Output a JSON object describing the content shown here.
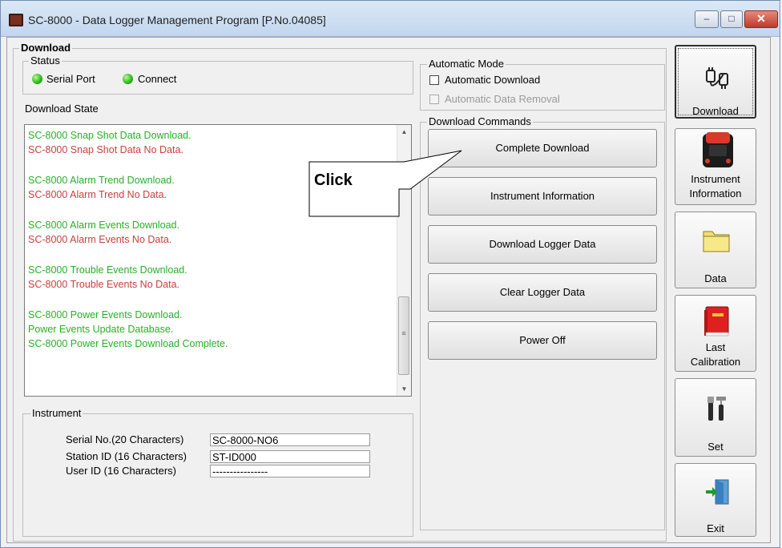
{
  "window": {
    "title": "SC-8000  - Data Logger Management Program [P.No.04085]",
    "controls": {
      "minimize": "–",
      "maximize": "□",
      "close": "✕"
    }
  },
  "download_group": {
    "label": "Download",
    "status": {
      "label": "Status",
      "serial_port": "Serial Port",
      "connect": "Connect"
    },
    "download_state_label": "Download State",
    "log_lines": [
      {
        "text": "SC-8000 Snap Shot Data Download.",
        "color": "#28b028"
      },
      {
        "text": "SC-8000 Snap Shot Data No Data.",
        "color": "#c84040"
      },
      {
        "text": "SC-8000 Alarm Trend Download.",
        "color": "#28b028"
      },
      {
        "text": "SC-8000 Alarm Trend No Data.",
        "color": "#c84040"
      },
      {
        "text": "SC-8000 Alarm Events Download.",
        "color": "#28b028"
      },
      {
        "text": "SC-8000 Alarm Events No Data.",
        "color": "#c84040"
      },
      {
        "text": "SC-8000 Trouble Events Download.",
        "color": "#28b028"
      },
      {
        "text": "SC-8000 Trouble Events No Data.",
        "color": "#c84040"
      },
      {
        "text": "SC-8000 Power Events Download.",
        "color": "#28b028"
      },
      {
        "text": "Power Events Update Database.",
        "color": "#28b028"
      },
      {
        "text": "SC-8000 Power Events Download Complete.",
        "color": "#28b028"
      }
    ],
    "automatic_mode": {
      "label": "Automatic Mode",
      "automatic_download": "Automatic Download",
      "automatic_data_removal": "Automatic Data Removal"
    },
    "commands": {
      "label": "Download Commands",
      "complete_download": "Complete Download",
      "instrument_information": "Instrument Information",
      "download_logger_data": "Download Logger Data",
      "clear_logger_data": "Clear Logger Data",
      "power_off": "Power Off"
    },
    "instrument": {
      "label": "Instrument",
      "serial_no_label": "Serial No.(20 Characters)",
      "serial_no_value": "SC-8000-NO6",
      "station_id_label": "Station ID (16 Characters)",
      "station_id_value": "ST-ID000",
      "user_id_label": "User ID (16 Characters)",
      "user_id_value": "----------------"
    }
  },
  "sidebar": {
    "download": "Download",
    "instrument_information_line1": "Instrument",
    "instrument_information_line2": "Information",
    "data": "Data",
    "last_calibration_line1": "Last",
    "last_calibration_line2": "Calibration",
    "set": "Set",
    "exit": "Exit"
  },
  "callout": {
    "text": "Click"
  },
  "colors": {
    "led_green": "#2ebd1a",
    "log_green": "#28b028",
    "log_red": "#c84040"
  }
}
